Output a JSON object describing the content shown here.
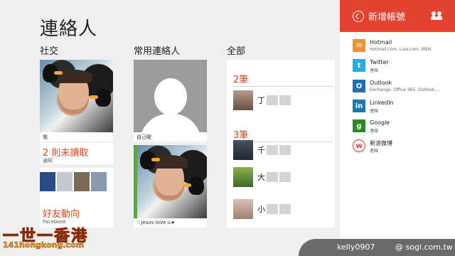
{
  "page": {
    "title": "連絡人"
  },
  "columns": {
    "social": "社交",
    "favorites": "常用連絡人",
    "all": "全部"
  },
  "social": {
    "me_caption": "我",
    "unread_label": "2 則未讀取",
    "unread_sub": "通知",
    "feed_label": "好友動向",
    "feed_sub": "Facebook"
  },
  "favorites": {
    "self_caption": "自己喔",
    "friend_caption": "☆Jesus love u★"
  },
  "all": {
    "groups": [
      {
        "label": "2筆",
        "contacts": [
          "丁"
        ]
      },
      {
        "label": "3筆",
        "contacts": [
          "千",
          "大",
          "小"
        ]
      }
    ]
  },
  "panel": {
    "title": "新增帳號",
    "accounts": [
      {
        "name": "Hotmail",
        "desc": "Hotmail.com, Live.com, MSN",
        "icon": "mail-icon",
        "color": "#f0912d"
      },
      {
        "name": "Twitter",
        "desc": "連線",
        "icon": "twitter-icon",
        "color": "#2aa9e0"
      },
      {
        "name": "Outlook",
        "desc": "Exchange, Office 365, Outlook,...",
        "icon": "outlook-icon",
        "color": "#1f6fb5"
      },
      {
        "name": "LinkedIn",
        "desc": "連線",
        "icon": "linkedin-icon",
        "color": "#1a79b0"
      },
      {
        "name": "Google",
        "desc": "連線",
        "icon": "google-icon",
        "color": "#2a8a2a"
      },
      {
        "name": "新浪微博",
        "desc": "連線",
        "icon": "weibo-icon",
        "color": "#e3302d"
      }
    ]
  },
  "footer": {
    "user": "kelly0907",
    "site": "@ sogi.com.tw",
    "logo": "一世一香港",
    "logo_url": "141hongkong.com"
  }
}
